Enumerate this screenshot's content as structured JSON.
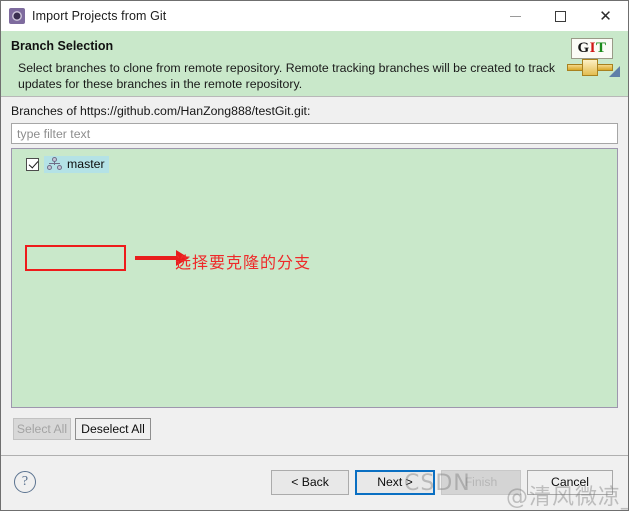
{
  "window": {
    "title": "Import Projects from Git",
    "icon": "eclipse-import-icon",
    "controls": {
      "minimize": "—",
      "maximize": "□",
      "close": "✕"
    }
  },
  "header": {
    "title": "Branch Selection",
    "description": "Select branches to clone from remote repository. Remote tracking branches will be created to track updates for these branches in the remote repository.",
    "logo": {
      "g": "G",
      "i": "I",
      "t": "T"
    },
    "background_color": "#c9e8ca"
  },
  "main": {
    "branches_label": "Branches of https://github.com/HanZong888/testGit.git:",
    "filter": {
      "placeholder": "type filter text",
      "value": ""
    },
    "branches": [
      {
        "name": "master",
        "checked": true,
        "selected": true,
        "icon": "branch-icon"
      }
    ],
    "list_background_color": "#c9e8ca",
    "buttons": {
      "select_all": "Select All",
      "select_all_enabled": false,
      "deselect_all": "Deselect All",
      "deselect_all_enabled": true
    }
  },
  "annotation": {
    "text": "选择要克隆的分支",
    "color": "#ee1b1b"
  },
  "footer": {
    "help": "?",
    "buttons": [
      {
        "label": "< Back",
        "state": "enabled"
      },
      {
        "label": "Next >",
        "state": "focused"
      },
      {
        "label": "Finish",
        "state": "disabled"
      },
      {
        "label": "Cancel",
        "state": "enabled"
      }
    ]
  },
  "watermark": {
    "left": "CSDN",
    "right": "@清风微凉_aaa"
  }
}
